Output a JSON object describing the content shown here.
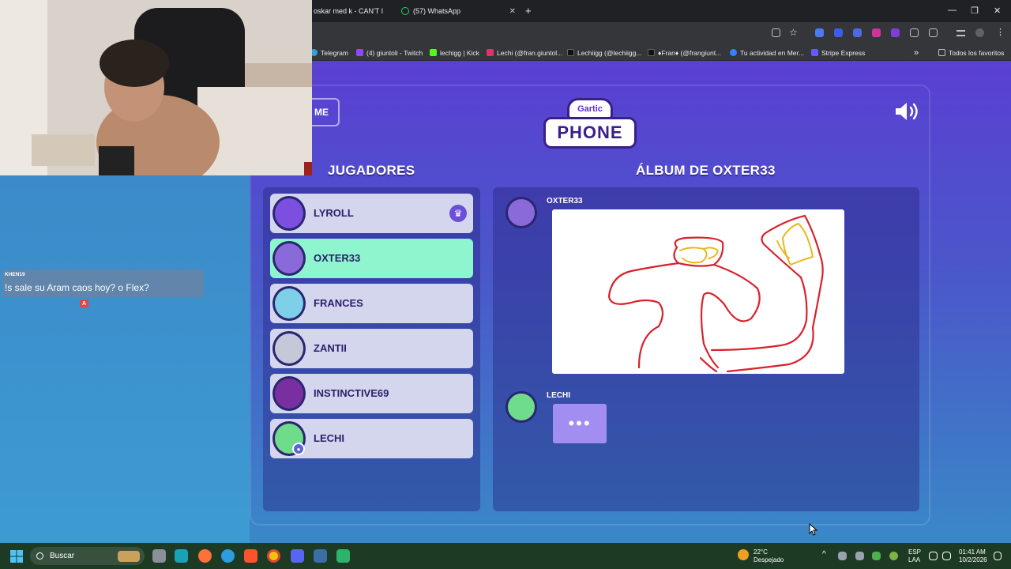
{
  "browser": {
    "tabs": [
      {
        "label": "oskar med k - CAN'T I"
      },
      {
        "label": "(57) WhatsApp"
      }
    ],
    "new_tab_symbol": "+",
    "bookmarks": [
      {
        "label": "Telegram",
        "color": "#2aa3e0"
      },
      {
        "label": "(4) giuntoli - Twitch",
        "color": "#9146ff"
      },
      {
        "label": "lechigg | Kick",
        "color": "#53fc18"
      },
      {
        "label": "Lechi (@fran.giuntol...",
        "color": "#e1306c"
      },
      {
        "label": "Lechiigg (@lechiigg...",
        "color": "#111111"
      },
      {
        "label": "♦Fran♦ (@frangiunt...",
        "color": "#111111"
      },
      {
        "label": "Tu actividad en Mer...",
        "color": "#3483fa"
      },
      {
        "label": "Stripe Express",
        "color": "#635bff"
      }
    ],
    "all_bookmarks_label": "Todos los favoritos"
  },
  "game": {
    "home_button_label": "ME",
    "logo_top": "Gartic",
    "logo_bottom": "PHONE",
    "players_title": "JUGADORES",
    "album_title": "ÁLBUM DE OXTER33",
    "players": [
      {
        "name": "LYROLL",
        "color": "#7c4fe0",
        "host": true,
        "active": false
      },
      {
        "name": "OXTER33",
        "color": "#8a6ad8",
        "host": false,
        "active": true
      },
      {
        "name": "FRANCES",
        "color": "#7ecfe8",
        "host": false,
        "active": false
      },
      {
        "name": "ZANTII",
        "color": "#c4c8d8",
        "host": false,
        "active": false
      },
      {
        "name": "INSTINCTIVE69",
        "color": "#7a2fa0",
        "host": false,
        "active": false
      },
      {
        "name": "LECHI",
        "color": "#6fdc8c",
        "host": false,
        "active": false
      }
    ],
    "album": [
      {
        "author": "OXTER33",
        "kind": "drawing"
      },
      {
        "author": "LECHI",
        "kind": "typing",
        "typing_indicator": "•••"
      }
    ]
  },
  "stream_chat": {
    "username": "KHEN19",
    "message": "!s sale su Aram caos hoy? o Flex?",
    "badge": "A"
  },
  "taskbar": {
    "search_placeholder": "Buscar",
    "weather_temp": "22°C",
    "weather_desc": "Despejado",
    "lang_top": "ESP",
    "lang_bottom": "LAA",
    "time": "01:41 AM",
    "date": "10/2/2026"
  }
}
